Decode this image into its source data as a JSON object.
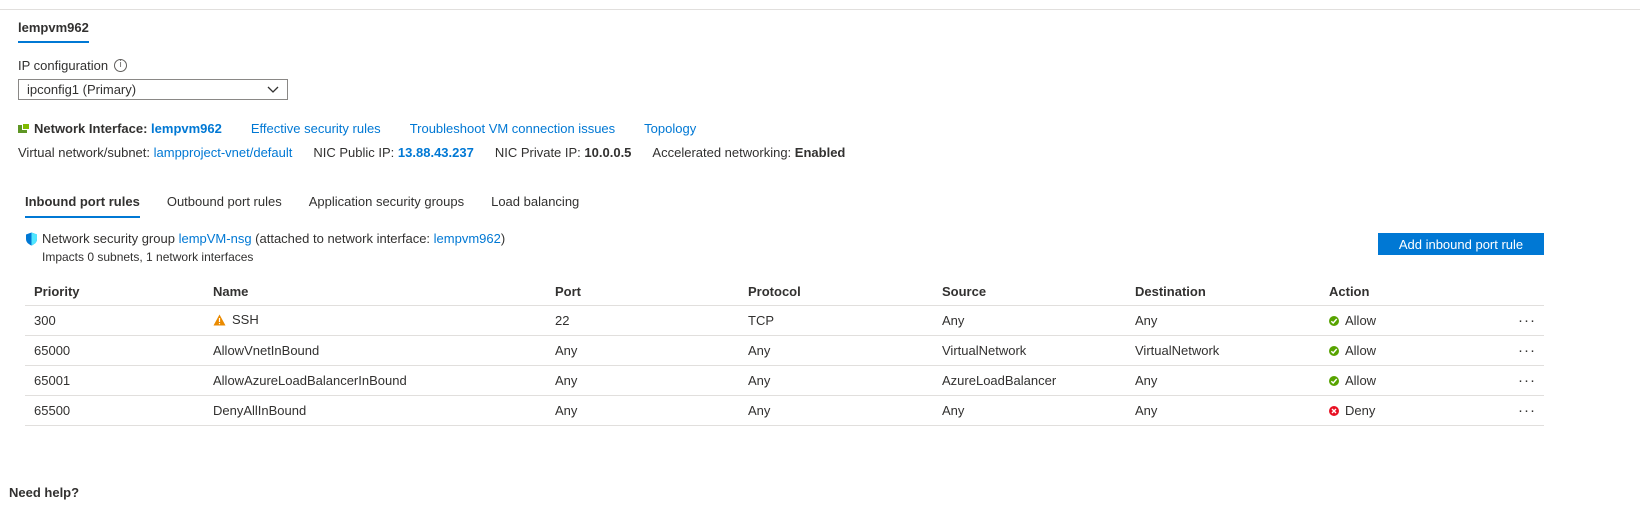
{
  "nic_tab": "lempvm962",
  "ip_config": {
    "label": "IP configuration",
    "selected": "ipconfig1 (Primary)"
  },
  "network_interface": {
    "label": "Network Interface:",
    "name": "lempvm962",
    "links": [
      "Effective security rules",
      "Troubleshoot VM connection issues",
      "Topology"
    ]
  },
  "details": {
    "vnet_label": "Virtual network/subnet:",
    "vnet_value": "lampproject-vnet/default",
    "public_ip_label": "NIC Public IP:",
    "public_ip_value": "13.88.43.237",
    "private_ip_label": "NIC Private IP:",
    "private_ip_value": "10.0.0.5",
    "accel_label": "Accelerated networking:",
    "accel_value": "Enabled"
  },
  "tabs": [
    "Inbound port rules",
    "Outbound port rules",
    "Application security groups",
    "Load balancing"
  ],
  "nsg": {
    "prefix": "Network security group",
    "name": "lempVM-nsg",
    "attached_text": "(attached to network interface:",
    "attached_nic": "lempvm962",
    "close_paren": ")",
    "impacts": "Impacts 0 subnets, 1 network interfaces"
  },
  "add_button": "Add inbound port rule",
  "table": {
    "headers": [
      "Priority",
      "Name",
      "Port",
      "Protocol",
      "Source",
      "Destination",
      "Action"
    ],
    "rows": [
      {
        "priority": "300",
        "name": "SSH",
        "port": "22",
        "protocol": "TCP",
        "source": "Any",
        "destination": "Any",
        "action": "Allow"
      },
      {
        "priority": "65000",
        "name": "AllowVnetInBound",
        "port": "Any",
        "protocol": "Any",
        "source": "VirtualNetwork",
        "destination": "VirtualNetwork",
        "action": "Allow"
      },
      {
        "priority": "65001",
        "name": "AllowAzureLoadBalancerInBound",
        "port": "Any",
        "protocol": "Any",
        "source": "AzureLoadBalancer",
        "destination": "Any",
        "action": "Allow"
      },
      {
        "priority": "65500",
        "name": "DenyAllInBound",
        "port": "Any",
        "protocol": "Any",
        "source": "Any",
        "destination": "Any",
        "action": "Deny"
      }
    ],
    "more_glyph": "···"
  },
  "help_heading": "Need help?",
  "colors": {
    "accent": "#0078d4",
    "allow": "#57a300",
    "deny": "#e81123",
    "warning": "#ea8a00"
  },
  "icons": [
    "info-icon",
    "chevron-down-icon",
    "network-interface-icon",
    "shield-icon",
    "warning-icon",
    "check-circle-icon",
    "error-circle-icon",
    "more-icon"
  ]
}
